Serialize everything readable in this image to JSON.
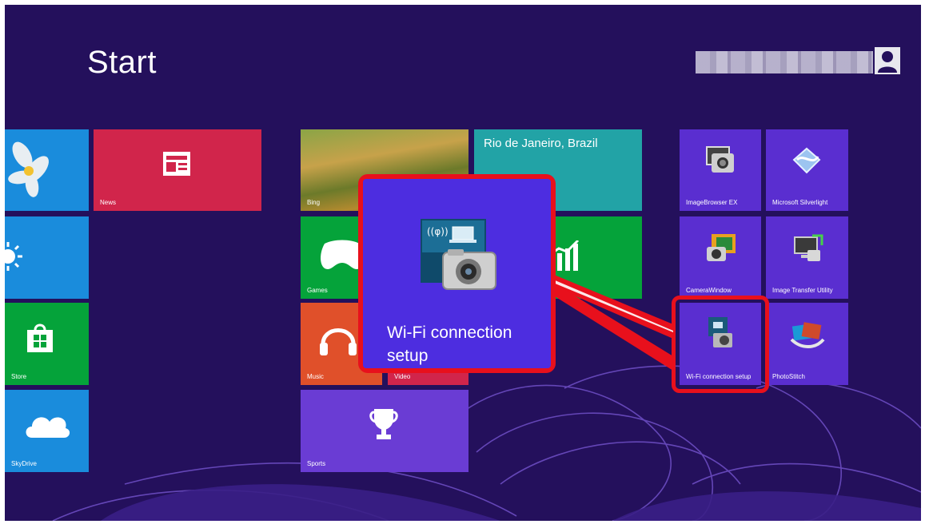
{
  "screen": {
    "title": "Start",
    "user": {
      "name_blurred": true
    }
  },
  "tiles": {
    "photos": {
      "label": ""
    },
    "news": {
      "label": "News"
    },
    "weather_partial": {
      "label": ""
    },
    "store": {
      "label": "Store"
    },
    "skydrive": {
      "label": "SkyDrive"
    },
    "bing": {
      "label": "Bing"
    },
    "travel": {
      "label": "Rio de Janeiro, Brazil"
    },
    "games": {
      "label": "Games"
    },
    "finance": {
      "label": ""
    },
    "music": {
      "label": "Music"
    },
    "video": {
      "label": "Video"
    },
    "sports": {
      "label": "Sports"
    },
    "imagebrowser": {
      "label": "ImageBrowser EX"
    },
    "silverlight": {
      "label": "Microsoft Silverlight"
    },
    "camerawindow": {
      "label": "CameraWindow"
    },
    "image_transfer": {
      "label": "Image Transfer Utility"
    },
    "wifi_small": {
      "label": "Wi-Fi connection setup"
    },
    "photostitch": {
      "label": "PhotoStitch"
    }
  },
  "callout": {
    "label": "Wi-Fi connection setup"
  },
  "colors": {
    "background": "#24105c",
    "highlight": "#e8101c",
    "tile_blue": "#1a8cdc",
    "tile_red": "#d1254b",
    "tile_green": "#05a33a",
    "tile_purple": "#6a3cd4",
    "tile_orange": "#e0502a",
    "tile_teal": "#22a3a6"
  },
  "icons": [
    "newspaper-icon",
    "sun-icon",
    "store-bag-icon",
    "cloud-icon",
    "gamepad-icon",
    "chart-icon",
    "headphones-icon",
    "trophy-icon",
    "camera-browser-icon",
    "silverlight-icon",
    "camera-window-icon",
    "transfer-icon",
    "wifi-camera-icon",
    "photostitch-icon",
    "user-avatar-icon"
  ]
}
